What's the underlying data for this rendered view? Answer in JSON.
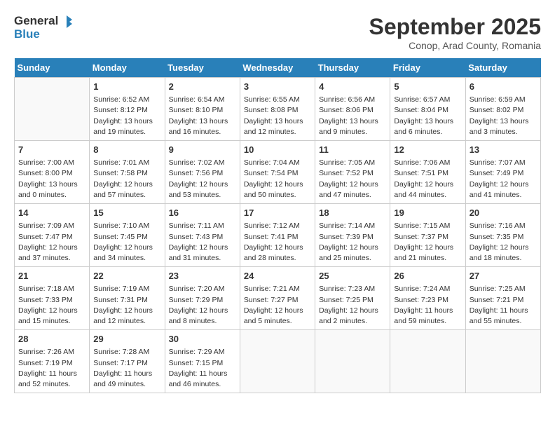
{
  "header": {
    "logo_general": "General",
    "logo_blue": "Blue",
    "month_title": "September 2025",
    "location": "Conop, Arad County, Romania"
  },
  "weekdays": [
    "Sunday",
    "Monday",
    "Tuesday",
    "Wednesday",
    "Thursday",
    "Friday",
    "Saturday"
  ],
  "weeks": [
    [
      {
        "day": "",
        "info": ""
      },
      {
        "day": "1",
        "info": "Sunrise: 6:52 AM\nSunset: 8:12 PM\nDaylight: 13 hours\nand 19 minutes."
      },
      {
        "day": "2",
        "info": "Sunrise: 6:54 AM\nSunset: 8:10 PM\nDaylight: 13 hours\nand 16 minutes."
      },
      {
        "day": "3",
        "info": "Sunrise: 6:55 AM\nSunset: 8:08 PM\nDaylight: 13 hours\nand 12 minutes."
      },
      {
        "day": "4",
        "info": "Sunrise: 6:56 AM\nSunset: 8:06 PM\nDaylight: 13 hours\nand 9 minutes."
      },
      {
        "day": "5",
        "info": "Sunrise: 6:57 AM\nSunset: 8:04 PM\nDaylight: 13 hours\nand 6 minutes."
      },
      {
        "day": "6",
        "info": "Sunrise: 6:59 AM\nSunset: 8:02 PM\nDaylight: 13 hours\nand 3 minutes."
      }
    ],
    [
      {
        "day": "7",
        "info": "Sunrise: 7:00 AM\nSunset: 8:00 PM\nDaylight: 13 hours\nand 0 minutes."
      },
      {
        "day": "8",
        "info": "Sunrise: 7:01 AM\nSunset: 7:58 PM\nDaylight: 12 hours\nand 57 minutes."
      },
      {
        "day": "9",
        "info": "Sunrise: 7:02 AM\nSunset: 7:56 PM\nDaylight: 12 hours\nand 53 minutes."
      },
      {
        "day": "10",
        "info": "Sunrise: 7:04 AM\nSunset: 7:54 PM\nDaylight: 12 hours\nand 50 minutes."
      },
      {
        "day": "11",
        "info": "Sunrise: 7:05 AM\nSunset: 7:52 PM\nDaylight: 12 hours\nand 47 minutes."
      },
      {
        "day": "12",
        "info": "Sunrise: 7:06 AM\nSunset: 7:51 PM\nDaylight: 12 hours\nand 44 minutes."
      },
      {
        "day": "13",
        "info": "Sunrise: 7:07 AM\nSunset: 7:49 PM\nDaylight: 12 hours\nand 41 minutes."
      }
    ],
    [
      {
        "day": "14",
        "info": "Sunrise: 7:09 AM\nSunset: 7:47 PM\nDaylight: 12 hours\nand 37 minutes."
      },
      {
        "day": "15",
        "info": "Sunrise: 7:10 AM\nSunset: 7:45 PM\nDaylight: 12 hours\nand 34 minutes."
      },
      {
        "day": "16",
        "info": "Sunrise: 7:11 AM\nSunset: 7:43 PM\nDaylight: 12 hours\nand 31 minutes."
      },
      {
        "day": "17",
        "info": "Sunrise: 7:12 AM\nSunset: 7:41 PM\nDaylight: 12 hours\nand 28 minutes."
      },
      {
        "day": "18",
        "info": "Sunrise: 7:14 AM\nSunset: 7:39 PM\nDaylight: 12 hours\nand 25 minutes."
      },
      {
        "day": "19",
        "info": "Sunrise: 7:15 AM\nSunset: 7:37 PM\nDaylight: 12 hours\nand 21 minutes."
      },
      {
        "day": "20",
        "info": "Sunrise: 7:16 AM\nSunset: 7:35 PM\nDaylight: 12 hours\nand 18 minutes."
      }
    ],
    [
      {
        "day": "21",
        "info": "Sunrise: 7:18 AM\nSunset: 7:33 PM\nDaylight: 12 hours\nand 15 minutes."
      },
      {
        "day": "22",
        "info": "Sunrise: 7:19 AM\nSunset: 7:31 PM\nDaylight: 12 hours\nand 12 minutes."
      },
      {
        "day": "23",
        "info": "Sunrise: 7:20 AM\nSunset: 7:29 PM\nDaylight: 12 hours\nand 8 minutes."
      },
      {
        "day": "24",
        "info": "Sunrise: 7:21 AM\nSunset: 7:27 PM\nDaylight: 12 hours\nand 5 minutes."
      },
      {
        "day": "25",
        "info": "Sunrise: 7:23 AM\nSunset: 7:25 PM\nDaylight: 12 hours\nand 2 minutes."
      },
      {
        "day": "26",
        "info": "Sunrise: 7:24 AM\nSunset: 7:23 PM\nDaylight: 11 hours\nand 59 minutes."
      },
      {
        "day": "27",
        "info": "Sunrise: 7:25 AM\nSunset: 7:21 PM\nDaylight: 11 hours\nand 55 minutes."
      }
    ],
    [
      {
        "day": "28",
        "info": "Sunrise: 7:26 AM\nSunset: 7:19 PM\nDaylight: 11 hours\nand 52 minutes."
      },
      {
        "day": "29",
        "info": "Sunrise: 7:28 AM\nSunset: 7:17 PM\nDaylight: 11 hours\nand 49 minutes."
      },
      {
        "day": "30",
        "info": "Sunrise: 7:29 AM\nSunset: 7:15 PM\nDaylight: 11 hours\nand 46 minutes."
      },
      {
        "day": "",
        "info": ""
      },
      {
        "day": "",
        "info": ""
      },
      {
        "day": "",
        "info": ""
      },
      {
        "day": "",
        "info": ""
      }
    ]
  ]
}
